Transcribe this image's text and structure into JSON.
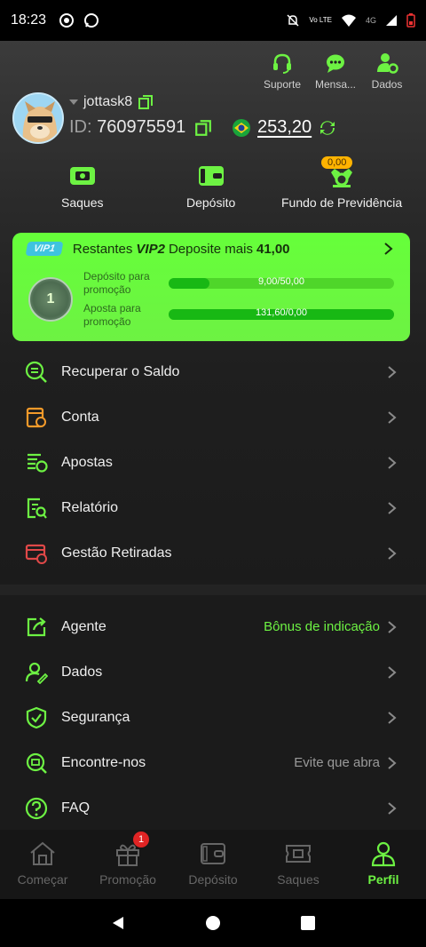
{
  "status": {
    "time": "18:23",
    "network": "4G"
  },
  "header": {
    "top_icons": [
      {
        "label": "Suporte",
        "icon": "headset-icon"
      },
      {
        "label": "Mensa...",
        "icon": "chat-icon"
      },
      {
        "label": "Dados",
        "icon": "user-gear-icon"
      }
    ],
    "username": "jottask8",
    "id_label": "ID:",
    "id_value": "760975591",
    "balance": "253,20"
  },
  "actions": [
    {
      "label": "Saques",
      "icon": "withdraw-icon"
    },
    {
      "label": "Depósito",
      "icon": "wallet-icon"
    },
    {
      "label": "Fundo de Previdência",
      "icon": "fund-icon",
      "badge": "0,00"
    }
  ],
  "vip": {
    "current_badge": "VIP1",
    "remaining_text": "Restantes",
    "next_level": "VIP2",
    "deposit_more_text": "Deposite mais",
    "deposit_more_amount": "41,00",
    "medal_level": "1",
    "deposit_label_line1": "Depósito para",
    "deposit_label_line2": "promoção",
    "deposit_progress_text": "9,00/50,00",
    "deposit_progress": 0.18,
    "bet_label_line1": "Aposta para",
    "bet_label_line2": "promoção",
    "bet_progress_text": "131,60/0,00",
    "bet_progress": 1.0
  },
  "menu1": [
    {
      "label": "Recuperar o Saldo",
      "icon": "recover-balance-icon"
    },
    {
      "label": "Conta",
      "icon": "account-icon"
    },
    {
      "label": "Apostas",
      "icon": "bets-icon"
    },
    {
      "label": "Relatório",
      "icon": "report-icon"
    },
    {
      "label": "Gestão Retiradas",
      "icon": "withdraw-management-icon"
    }
  ],
  "menu2": [
    {
      "label": "Agente",
      "icon": "share-icon",
      "extra": "Bônus de indicação"
    },
    {
      "label": "Dados",
      "icon": "user-edit-icon",
      "extra": ""
    },
    {
      "label": "Segurança",
      "icon": "shield-icon",
      "extra": ""
    },
    {
      "label": "Encontre-nos",
      "icon": "find-us-icon",
      "extra": "Evite que abra"
    },
    {
      "label": "FAQ",
      "icon": "question-icon",
      "extra": ""
    }
  ],
  "tabs": [
    {
      "label": "Começar",
      "icon": "home-icon",
      "active": false
    },
    {
      "label": "Promoção",
      "icon": "gift-icon",
      "active": false,
      "badge": "1"
    },
    {
      "label": "Depósito",
      "icon": "wallet-icon",
      "active": false
    },
    {
      "label": "Saques",
      "icon": "ticket-icon",
      "active": false
    },
    {
      "label": "Perfil",
      "icon": "profile-icon",
      "active": true
    }
  ],
  "colors": {
    "accent": "#6df243",
    "orange": "#f39a2a",
    "red": "#e04848"
  }
}
